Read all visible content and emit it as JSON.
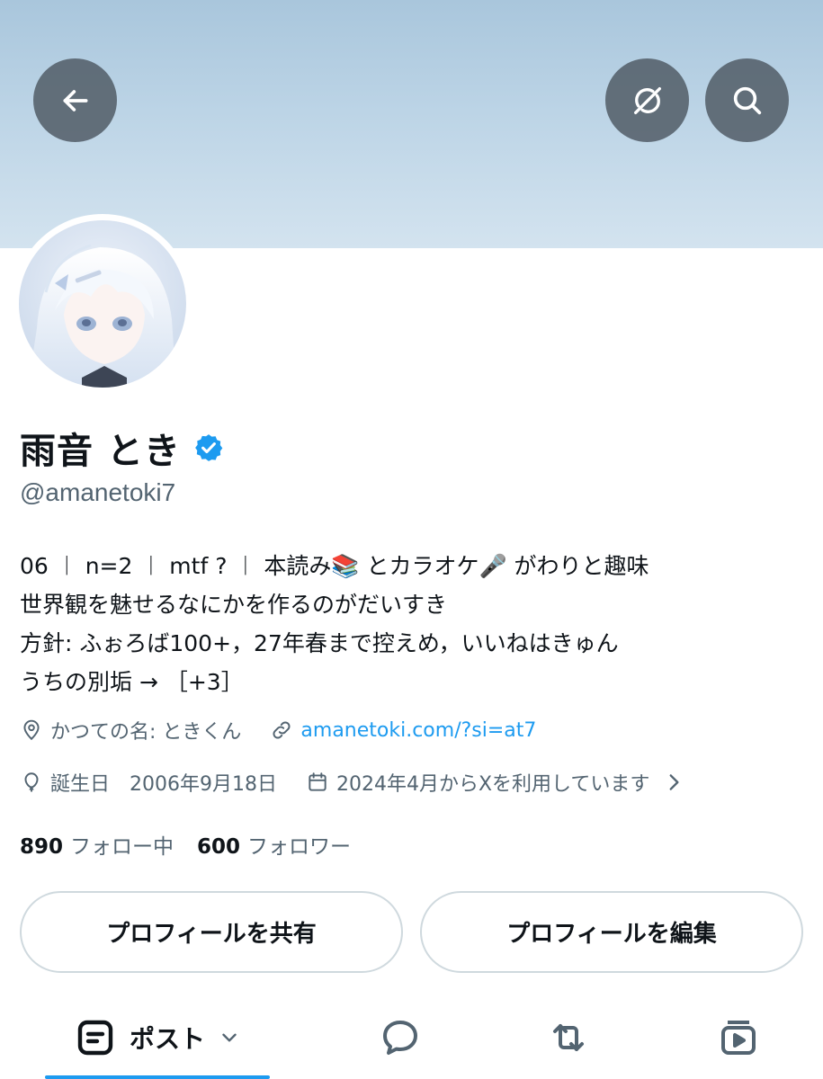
{
  "header": {
    "back_icon": "arrow-left-icon",
    "grok_icon": "grok-icon",
    "search_icon": "search-icon",
    "banner_color": "#bcd4e6"
  },
  "profile": {
    "display_name": "雨音 とき",
    "verified": true,
    "verified_color": "#1d9bf0",
    "handle": "@amanetoki7",
    "bio_lines": [
      "06 ︱ n=2 ︱ mtf ? ︱ 本読み📚 とカラオケ🎤 がわりと趣味",
      "世界観を魅せるなにかを作るのがだいすき",
      "方針: ふぉろば100+，27年春まで控えめ，いいねはきゅん",
      "うちの別垢 → ［+3］"
    ],
    "location_icon": "location-pin-icon",
    "location": "かつての名: ときくん",
    "link_icon": "link-icon",
    "website": "amanetoki.com/?si=at7",
    "birthday_icon": "balloon-icon",
    "birthday": "誕生日　2006年9月18日",
    "joined_icon": "calendar-icon",
    "joined": "2024年4月からXを利用しています",
    "following_count": "890",
    "following_label": "フォロー中",
    "followers_count": "600",
    "followers_label": "フォロワー",
    "link_color": "#1d9bf0"
  },
  "actions": {
    "share_label": "プロフィールを共有",
    "edit_label": "プロフィールを編集"
  },
  "tabs": {
    "posts_label": "ポスト",
    "posts_icon": "posts-list-icon",
    "replies_icon": "reply-bubble-icon",
    "reposts_icon": "repost-icon",
    "media_icon": "video-icon",
    "active_color": "#1d9bf0"
  }
}
